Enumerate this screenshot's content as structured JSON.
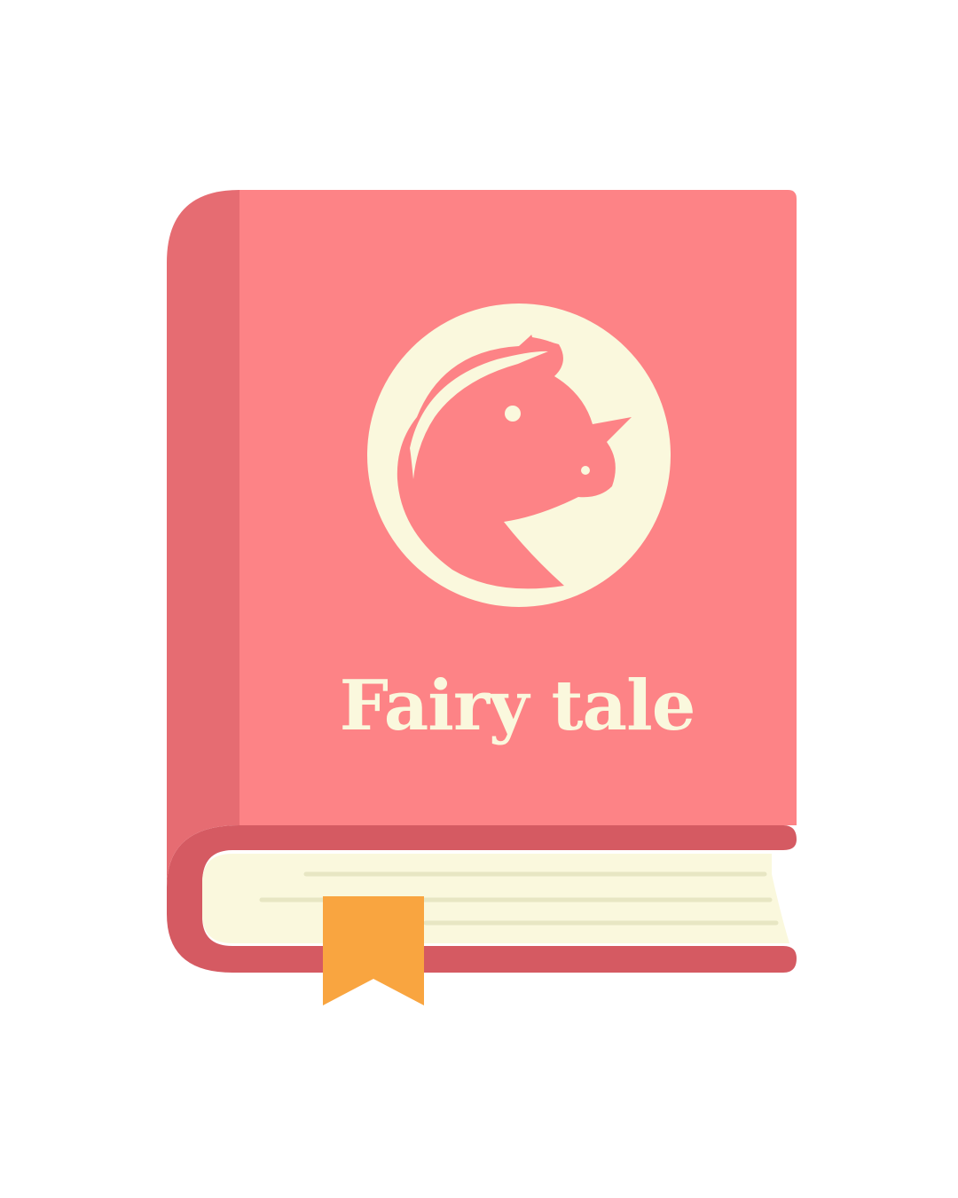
{
  "book": {
    "title": "Fairy tale",
    "emblem_icon": "unicorn-icon",
    "bookmark_icon": "bookmark-icon"
  },
  "colors": {
    "background": "#ffffff",
    "cover": "#FD8386",
    "spine": "#E66C72",
    "binding": "#D55A62",
    "pages": "#FAF8DD",
    "page_line": "#E7E6C3",
    "cream": "#FAF8DD",
    "bookmark": "#F9A540"
  }
}
